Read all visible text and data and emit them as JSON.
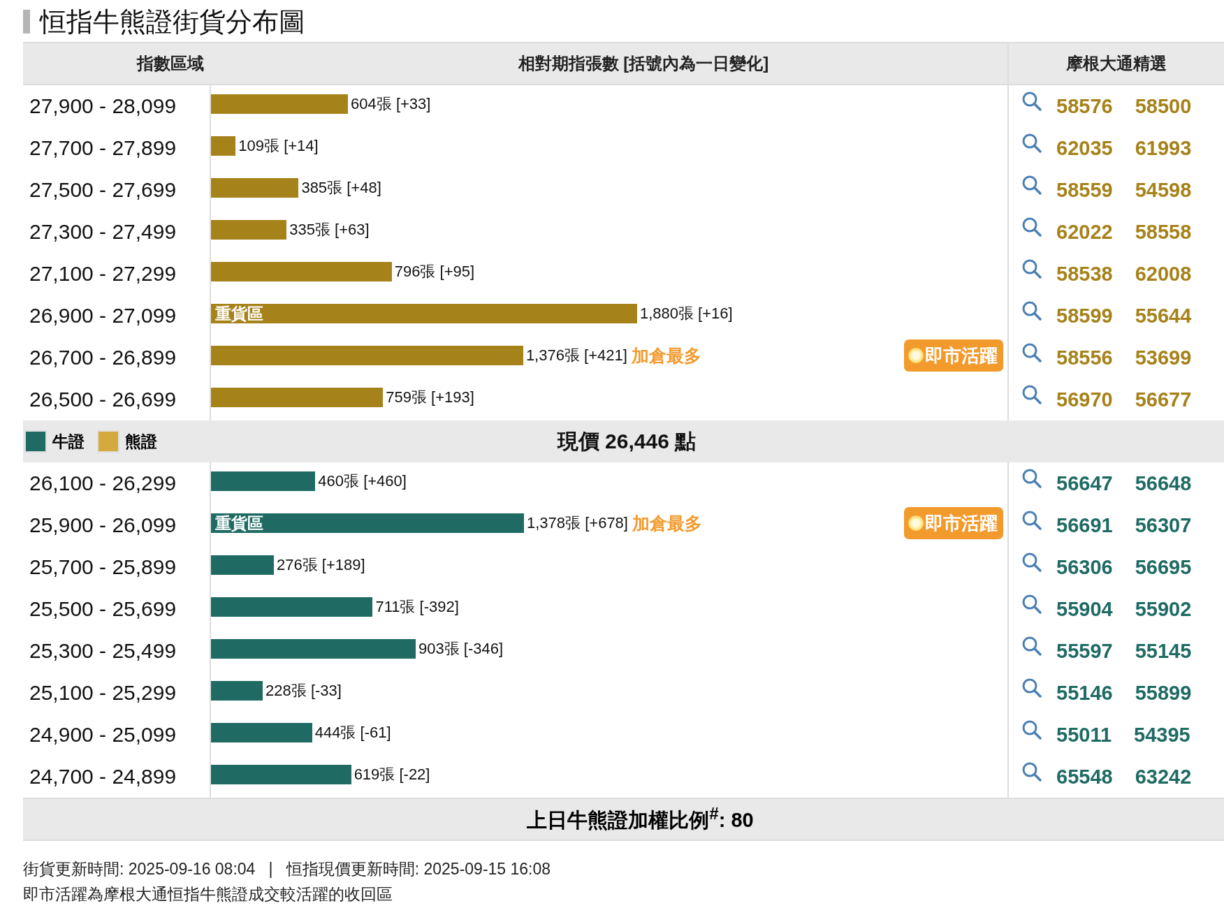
{
  "title": "恒指牛熊證街貨分布圖",
  "columns": [
    "指數區域",
    "相對期指張數 [括號內為一日變化]",
    "摩根大通精選"
  ],
  "groups": [
    {
      "kind": "bear",
      "rows": [
        {
          "range": "27,900 - 28,099",
          "level": 0.172,
          "reading": "604張 [+33]",
          "codes": [
            "58576",
            "58500"
          ]
        },
        {
          "range": "27,700 - 27,899",
          "level": 0.031,
          "reading": "109張 [+14]",
          "codes": [
            "62035",
            "61993"
          ]
        },
        {
          "range": "27,500 - 27,699",
          "level": 0.11,
          "reading": "385張 [+48]",
          "codes": [
            "58559",
            "54598"
          ]
        },
        {
          "range": "27,300 - 27,499",
          "level": 0.095,
          "reading": "335張 [+63]",
          "codes": [
            "62022",
            "58558"
          ]
        },
        {
          "range": "27,100 - 27,299",
          "level": 0.227,
          "reading": "796張 [+95]",
          "codes": [
            "58538",
            "62008"
          ]
        },
        {
          "range": "26,900 - 27,099",
          "level": 0.535,
          "bar_label": "重貨區",
          "reading": "1,880張 [+16]",
          "codes": [
            "58599",
            "55644"
          ]
        },
        {
          "range": "26,700 - 26,899",
          "level": 0.392,
          "reading": "1,376張 [+421]",
          "note": "加倉最多",
          "badge": "即市活躍",
          "codes": [
            "58556",
            "53699"
          ]
        },
        {
          "range": "26,500 - 26,699",
          "level": 0.216,
          "reading": "759張 [+193]",
          "codes": [
            "56970",
            "56677"
          ]
        }
      ]
    },
    {
      "kind": "bull",
      "rows": [
        {
          "range": "26,100 - 26,299",
          "level": 0.131,
          "reading": "460張 [+460]",
          "codes": [
            "56647",
            "56648"
          ]
        },
        {
          "range": "25,900 - 26,099",
          "level": 0.393,
          "bar_label": "重貨區",
          "reading": "1,378張 [+678]",
          "note": "加倉最多",
          "badge": "即市活躍",
          "codes": [
            "56691",
            "56307"
          ]
        },
        {
          "range": "25,700 - 25,899",
          "level": 0.079,
          "reading": "276張 [+189]",
          "codes": [
            "56306",
            "56695"
          ]
        },
        {
          "range": "25,500 - 25,699",
          "level": 0.203,
          "reading": "711張 [-392]",
          "codes": [
            "55904",
            "55902"
          ]
        },
        {
          "range": "25,300 - 25,499",
          "level": 0.257,
          "reading": "903張 [-346]",
          "codes": [
            "55597",
            "55145"
          ]
        },
        {
          "range": "25,100 - 25,299",
          "level": 0.065,
          "reading": "228張 [-33]",
          "codes": [
            "55146",
            "55899"
          ]
        },
        {
          "range": "24,900 - 25,099",
          "level": 0.127,
          "reading": "444張 [-61]",
          "codes": [
            "55011",
            "54395"
          ]
        },
        {
          "range": "24,700 - 24,899",
          "level": 0.176,
          "reading": "619張 [-22]",
          "codes": [
            "65548",
            "63242"
          ]
        }
      ]
    }
  ],
  "legend": [
    {
      "label": "牛證",
      "color": "#1f6b64"
    },
    {
      "label": "熊證",
      "color": "#d4aa3f"
    }
  ],
  "current_price": "現價 26,446 點",
  "weighted_ratio": "上日牛熊證加權比例$^{#}$: 80",
  "notes": [
    "街貨更新時間: 2025-09-16 08:04   |   恒指現價更新時間: 2025-09-15 16:08",
    "即市活躍為摩根大通恒指牛熊證成交較活躍的收回區"
  ]
}
